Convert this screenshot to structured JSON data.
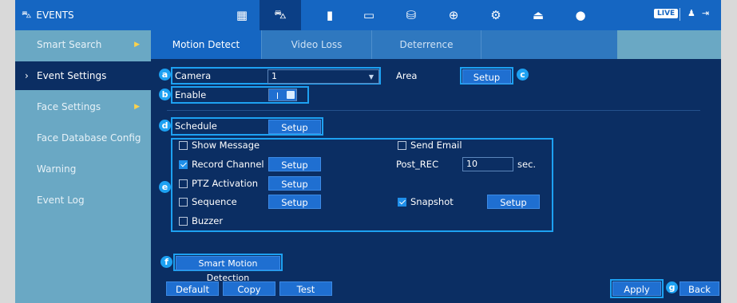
{
  "topbar": {
    "title": "EVENTS",
    "live": "LIVE"
  },
  "sidebar": {
    "items": [
      {
        "label": "Smart Search"
      },
      {
        "label": "Event Settings"
      },
      {
        "label": "Face Settings"
      },
      {
        "label": "Face Database Config"
      },
      {
        "label": "Warning"
      },
      {
        "label": "Event Log"
      }
    ]
  },
  "tabs": [
    {
      "label": "Motion Detect"
    },
    {
      "label": "Video Loss"
    },
    {
      "label": "Deterrence"
    }
  ],
  "form": {
    "camera_label": "Camera",
    "camera_value": "1",
    "area_label": "Area",
    "area_button": "Setup",
    "enable_label": "Enable",
    "schedule_label": "Schedule",
    "schedule_button": "Setup",
    "show_message": "Show Message",
    "send_email": "Send Email",
    "record_channel": "Record Channel",
    "record_button": "Setup",
    "post_rec_label": "Post_REC",
    "post_rec_value": "10",
    "post_rec_unit": "sec.",
    "ptz_activation": "PTZ Activation",
    "ptz_button": "Setup",
    "sequence": "Sequence",
    "sequence_button": "Setup",
    "snapshot": "Snapshot",
    "snapshot_button": "Setup",
    "buzzer": "Buzzer",
    "smart_motion": "Smart Motion Detection"
  },
  "footer": {
    "default": "Default",
    "copy": "Copy",
    "test": "Test",
    "apply": "Apply",
    "back": "Back"
  },
  "markers": {
    "a": "a",
    "b": "b",
    "c": "c",
    "d": "d",
    "e": "e",
    "f": "f",
    "g": "g"
  },
  "icons": [
    "events-icon",
    "grid-icon",
    "alarm-icon",
    "usb-icon",
    "monitor-icon",
    "hdd-icon",
    "network-icon",
    "settings-icon",
    "backup-icon",
    "account-icon",
    "user-icon",
    "logout-icon"
  ]
}
